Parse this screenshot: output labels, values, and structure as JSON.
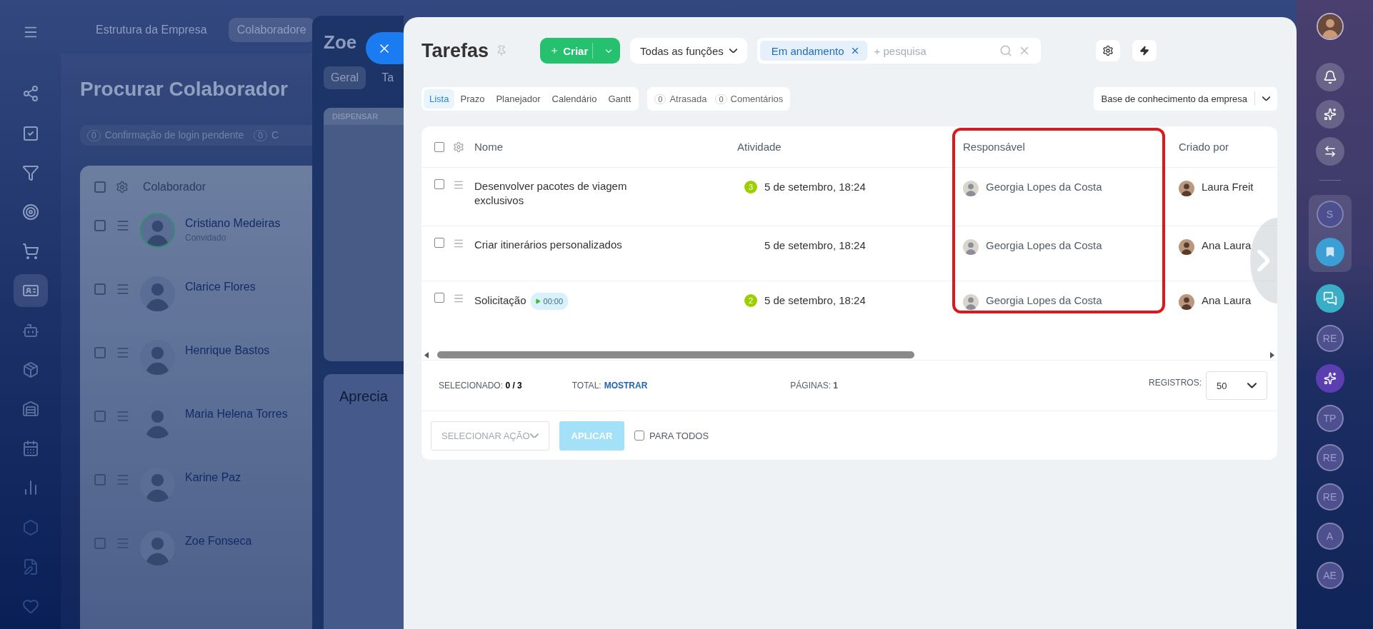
{
  "nav_items": [
    {
      "selected": false
    },
    {
      "selected": false
    },
    {
      "selected": false
    },
    {
      "selected": false
    },
    {
      "selected": false
    },
    {
      "selected": true
    },
    {
      "selected": false
    },
    {
      "selected": false
    },
    {
      "selected": false
    },
    {
      "selected": false
    },
    {
      "selected": false
    },
    {
      "selected": false
    },
    {
      "selected": false
    },
    {
      "selected": false
    }
  ],
  "background_app": {
    "tabs": [
      {
        "label": "Estrutura da Empresa",
        "selected": false
      },
      {
        "label": "Colaboradore",
        "selected": true
      }
    ],
    "title": "Procurar Colaborador",
    "counters": [
      {
        "count": "0",
        "label": "Confirmação de login pendente"
      },
      {
        "count": "0",
        "label": "C"
      }
    ],
    "table": {
      "column": "Colaborador",
      "all_checked": false,
      "rows": [
        {
          "checked": false,
          "name": "Cristiano Medeiras",
          "note": "Convidado",
          "online": true
        },
        {
          "checked": false,
          "name": "Clarice Flores",
          "online": false
        },
        {
          "checked": false,
          "name": "Henrique Bastos",
          "online": false
        },
        {
          "checked": false,
          "name": "Maria Helena Torres",
          "online": false
        },
        {
          "checked": false,
          "name": "Karine Paz",
          "online": false
        },
        {
          "checked": false,
          "name": "Zoe Fonseca",
          "online": false
        }
      ]
    }
  },
  "profile_panel": {
    "title": "Zoe",
    "tabs": [
      {
        "label": "Geral",
        "selected": true
      },
      {
        "label": "Ta",
        "selected": false
      }
    ],
    "card_header": "DISPENSAR",
    "card_title": "Aprecia"
  },
  "tasks": {
    "title": "Tarefas",
    "create_button": "Criar",
    "role_filter": "Todas as funções",
    "search": {
      "chip": "Em andamento",
      "placeholder": "+ pesquisa"
    },
    "views": [
      {
        "label": "Lista",
        "selected": true
      },
      {
        "label": "Prazo",
        "selected": false
      },
      {
        "label": "Planejador",
        "selected": false
      },
      {
        "label": "Calendário",
        "selected": false
      },
      {
        "label": "Gantt",
        "selected": false
      }
    ],
    "counters": [
      {
        "count": "0",
        "label": "Atrasada"
      },
      {
        "count": "0",
        "label": "Comentários"
      }
    ],
    "knowledge_base": "Base de conhecimento da empresa",
    "table": {
      "all_checked": false,
      "columns": [
        {
          "label": "Nome",
          "highlighted": false
        },
        {
          "label": "Atividade",
          "highlighted": false
        },
        {
          "label": "Responsável",
          "highlighted": true
        },
        {
          "label": "Criado por",
          "highlighted": false
        }
      ],
      "rows": [
        {
          "checked": false,
          "name": "Desenvolver pacotes de viagem exclusivos",
          "counter": "3",
          "activity": "5 de setembro, 18:24",
          "responsible": "Georgia Lopes da Costa",
          "creator": "Laura Freit"
        },
        {
          "checked": false,
          "name": "Criar itinerários personalizados",
          "activity": "5 de setembro, 18:24",
          "responsible": "Georgia Lopes da Costa",
          "creator": "Ana Laura"
        },
        {
          "checked": false,
          "name": "Solicitação",
          "timer": "00:00",
          "counter": "2",
          "activity": "5 de setembro, 18:24",
          "responsible": "Georgia Lopes da Costa",
          "creator": "Ana Laura"
        }
      ]
    },
    "footer": {
      "selected_label": "SELECIONADO:",
      "selected_value": "0 / 3",
      "total_label": "TOTAL:",
      "total_link": "MOSTRAR",
      "pages_label": "PÁGINAS:",
      "pages_value": "1",
      "records_label": "REGISTROS:",
      "records_value": "50"
    },
    "actions": {
      "select": "SELECIONAR AÇÃO",
      "apply": "APLICAR",
      "apply_disabled": true,
      "for_all": "PARA TODOS",
      "for_all_checked": false
    }
  },
  "right_bar": {
    "pinned": [
      {
        "kind": "letter",
        "label": "S"
      },
      {
        "kind": "bookmark"
      }
    ],
    "items": [
      {
        "kind": "chat"
      },
      {
        "kind": "letter",
        "label": "RE"
      },
      {
        "kind": "copilot"
      },
      {
        "kind": "letter",
        "label": "TP"
      },
      {
        "kind": "letter",
        "label": "RE"
      },
      {
        "kind": "letter",
        "label": "RE"
      },
      {
        "kind": "letter",
        "label": "A"
      },
      {
        "kind": "letter",
        "label": "AE"
      }
    ]
  }
}
